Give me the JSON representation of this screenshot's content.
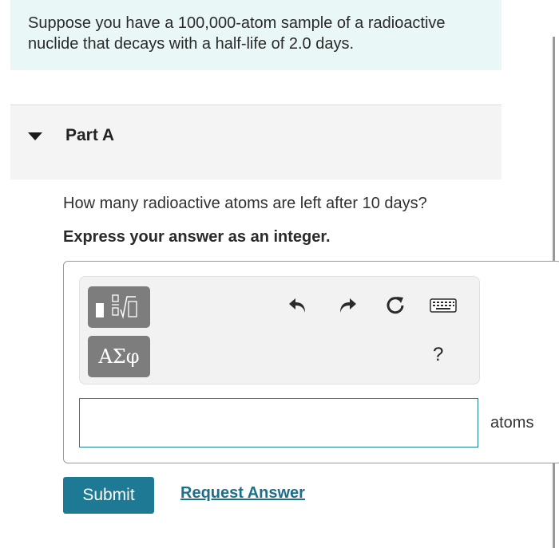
{
  "problem": {
    "line1": "Suppose you have a 100,000-atom sample of a radioactive",
    "line2": "nuclide that decays with a half-life of 2.0 days."
  },
  "part": {
    "title": "Part A",
    "question": "How many radioactive atoms are left after 10 days?",
    "instruction": "Express your answer as an integer."
  },
  "toolbar": {
    "templates_icon": "fraction-radical-template-icon",
    "symbols_label": "ΑΣφ",
    "undo_icon": "undo-icon",
    "redo_icon": "redo-icon",
    "reset_icon": "reset-icon",
    "keyboard_icon": "keyboard-icon",
    "help_label": "?"
  },
  "answer": {
    "value": "",
    "units": "atoms"
  },
  "actions": {
    "submit_label": "Submit",
    "request_label": "Request Answer"
  },
  "colors": {
    "intro_bg": "#e9f7f7",
    "accent": "#1e7a94",
    "toolbar_button": "#7d7d7d"
  }
}
